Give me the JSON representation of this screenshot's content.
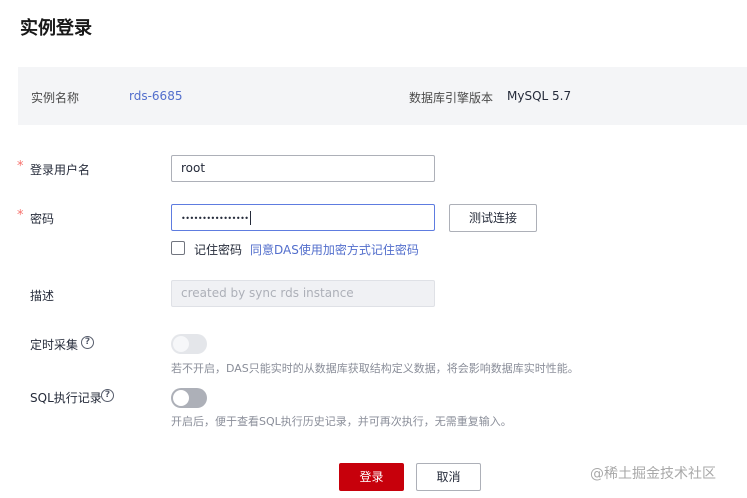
{
  "page_title": "实例登录",
  "instance": {
    "name_label": "实例名称",
    "name_value": "rds-6685",
    "engine_label": "数据库引擎版本",
    "engine_value": "MySQL 5.7"
  },
  "form": {
    "username": {
      "required_mark": "*",
      "label": "登录用户名",
      "value": "root"
    },
    "password": {
      "required_mark": "*",
      "label": "密码",
      "value": "••••••••••••••••"
    },
    "test_connection_label": "测试连接",
    "remember": {
      "label": "记住密码",
      "checked": false,
      "link": "同意DAS使用加密方式记住密码"
    },
    "description": {
      "label": "描述",
      "placeholder": "created by sync rds instance"
    },
    "scheduled_collection": {
      "label": "定时采集",
      "enabled": false,
      "hint": "若不开启，DAS只能实时的从数据库获取结构定义数据，将会影响数据库实时性能。"
    },
    "sql_log": {
      "label": "SQL执行记录",
      "enabled": false,
      "hint": "开启后，便于查看SQL执行历史记录，并可再次执行，无需重复输入。"
    }
  },
  "actions": {
    "login_label": "登录",
    "cancel_label": "取消"
  },
  "watermark": "@稀土掘金技术社区",
  "colors": {
    "primary": "#c7000b",
    "link": "#526ecc",
    "required": "#f66f6a",
    "focus_border": "#5e7ce0"
  },
  "icons": {
    "help": "question-circle-icon"
  }
}
